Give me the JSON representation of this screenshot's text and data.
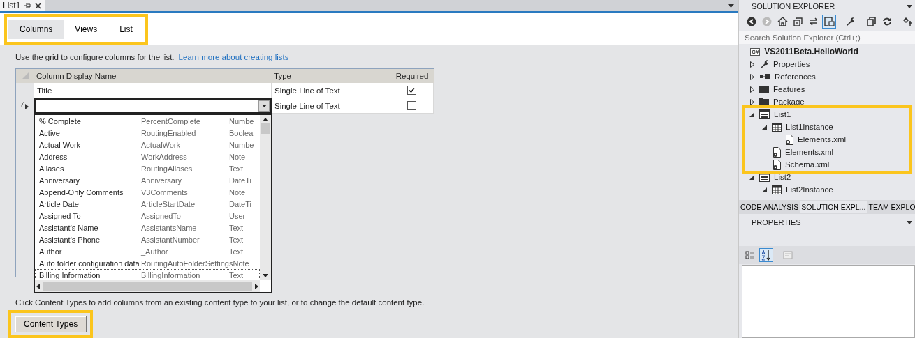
{
  "document_tab": {
    "title": "List1"
  },
  "designer_tabs": [
    {
      "label": "Columns",
      "selected": true
    },
    {
      "label": "Views",
      "selected": false
    },
    {
      "label": "List",
      "selected": false
    }
  ],
  "intro": {
    "text": "Use the grid to configure columns for the list.",
    "link": "Learn more about creating lists"
  },
  "grid": {
    "columns": [
      "Column Display Name",
      "Type",
      "Required"
    ],
    "rows": [
      {
        "name": "Title",
        "type": "Single Line of Text",
        "required": true,
        "editing": false
      },
      {
        "name": "",
        "type": "Single Line of Text",
        "required": false,
        "editing": true
      }
    ]
  },
  "dropdown": [
    {
      "name": "% Complete",
      "internal": "PercentComplete",
      "type": "Numbe",
      "focused": false
    },
    {
      "name": "Active",
      "internal": "RoutingEnabled",
      "type": "Boolea",
      "focused": false
    },
    {
      "name": "Actual Work",
      "internal": "ActualWork",
      "type": "Numbe",
      "focused": false
    },
    {
      "name": "Address",
      "internal": "WorkAddress",
      "type": "Note",
      "focused": false
    },
    {
      "name": "Aliases",
      "internal": "RoutingAliases",
      "type": "Text",
      "focused": false
    },
    {
      "name": "Anniversary",
      "internal": "Anniversary",
      "type": "DateTi",
      "focused": false
    },
    {
      "name": "Append-Only Comments",
      "internal": "V3Comments",
      "type": "Note",
      "focused": false
    },
    {
      "name": "Article Date",
      "internal": "ArticleStartDate",
      "type": "DateTi",
      "focused": false
    },
    {
      "name": "Assigned To",
      "internal": "AssignedTo",
      "type": "User",
      "focused": false
    },
    {
      "name": "Assistant's Name",
      "internal": "AssistantsName",
      "type": "Text",
      "focused": false
    },
    {
      "name": "Assistant's Phone",
      "internal": "AssistantNumber",
      "type": "Text",
      "focused": false
    },
    {
      "name": "Author",
      "internal": "_Author",
      "type": "Text",
      "focused": false
    },
    {
      "name": "Auto folder configuration data",
      "internal": "RoutingAutoFolderSettings",
      "type": "Note",
      "focused": false
    },
    {
      "name": "Billing Information",
      "internal": "BillingInformation",
      "type": "Text",
      "focused": true
    }
  ],
  "footer": {
    "text": "Click Content Types to add columns from an existing content type to your list, or to change the default content type.",
    "button": "Content Types"
  },
  "solution_explorer": {
    "title": "SOLUTION EXPLORER",
    "search": {
      "placeholder": "Search Solution Explorer (Ctrl+;)"
    },
    "project": {
      "badge": "C#",
      "name": "VS2011Beta.HelloWorld"
    },
    "tree": [
      {
        "label": "Properties",
        "kind": "wrench",
        "expanded": false
      },
      {
        "label": "References",
        "kind": "references",
        "expanded": false
      },
      {
        "label": "Features",
        "kind": "folder",
        "expanded": false
      },
      {
        "label": "Package",
        "kind": "folder",
        "expanded": false
      },
      {
        "label": "List1",
        "kind": "list",
        "expanded": true,
        "children": [
          {
            "label": "List1Instance",
            "kind": "table",
            "expanded": true,
            "children": [
              {
                "label": "Elements.xml",
                "kind": "xml"
              }
            ]
          },
          {
            "label": "Elements.xml",
            "kind": "xml"
          },
          {
            "label": "Schema.xml",
            "kind": "xml"
          }
        ]
      },
      {
        "label": "List2",
        "kind": "list",
        "expanded": true,
        "children": [
          {
            "label": "List2Instance",
            "kind": "table",
            "expanded": true
          }
        ]
      }
    ]
  },
  "panel_tabs": [
    {
      "label": "CODE ANALYSIS",
      "selected": false
    },
    {
      "label": "SOLUTION EXPL...",
      "selected": true
    },
    {
      "label": "TEAM EXPLO",
      "selected": false
    }
  ],
  "properties": {
    "title": "PROPERTIES",
    "sort_buttons": [
      {
        "kind": "categorized",
        "selected": false
      },
      {
        "kind": "alphabetical",
        "selected": true
      }
    ]
  }
}
